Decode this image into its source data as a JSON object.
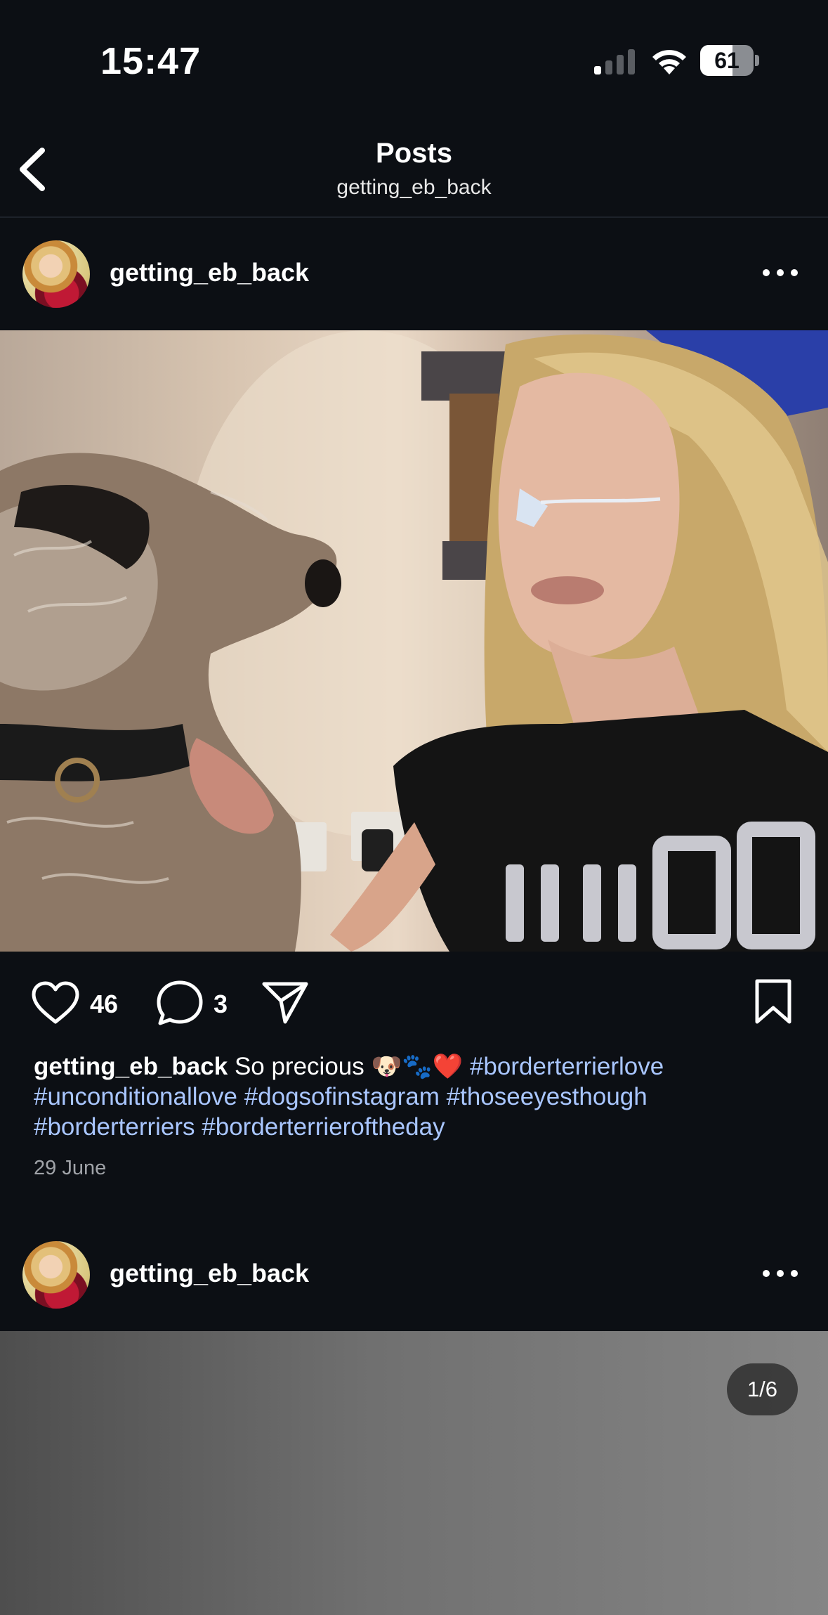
{
  "status_bar": {
    "time": "15:47",
    "battery": "61",
    "battery_level": 0.61,
    "signal_icon": "cellular-signal-icon",
    "wifi_icon": "wifi-icon"
  },
  "header": {
    "title": "Posts",
    "subtitle": "getting_eb_back",
    "back_icon": "chevron-left-icon"
  },
  "posts": [
    {
      "username": "getting_eb_back",
      "image_description_icon": "photo",
      "likes": "46",
      "comments": "3",
      "caption": {
        "username": "getting_eb_back",
        "text": "So precious 🐶🐾❤️",
        "hashtags": [
          "#borderterrierlove",
          "#unconditionallove",
          "#dogsofinstagram",
          "#thoseeyesthough",
          "#borderterriers",
          "#borderterrieroftheday"
        ]
      },
      "date": "29 June"
    },
    {
      "username": "getting_eb_back",
      "carousel_indicator": "1/6"
    }
  ],
  "colors": {
    "background": "#0c0f14",
    "hashtag": "#a9c6ff",
    "date": "#a0a3a8"
  }
}
